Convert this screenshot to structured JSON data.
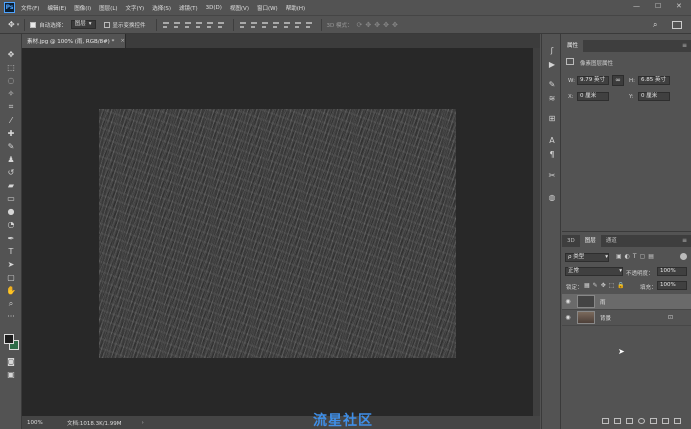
{
  "menubar": {
    "logo": "Ps",
    "items": [
      "文件(F)",
      "编辑(E)",
      "图像(I)",
      "图层(L)",
      "文字(Y)",
      "选择(S)",
      "滤镜(T)",
      "3D(D)",
      "视图(V)",
      "窗口(W)",
      "帮助(H)"
    ],
    "minimize": "—",
    "maximize": "☐",
    "close": "✕"
  },
  "options": {
    "auto_select_label": "自动选择：",
    "auto_select_value": "图层",
    "show_transform_label": "显示变换控件",
    "mode_3d_label": "3D 模式："
  },
  "document": {
    "tab_label": "素材.jpg @ 100% (雨, RGB/8#) *",
    "close": "×"
  },
  "status": {
    "zoom": "100%",
    "doc_info": "文档:1018.3K/1.99M",
    "arrow": "›"
  },
  "watermark": "流星社区",
  "properties": {
    "tab": "属性",
    "section": "像素图层属性",
    "w_label": "W:",
    "w_value": "9.79 英寸",
    "h_label": "H:",
    "h_value": "6.85 英寸",
    "x_label": "X:",
    "x_value": "0 厘米",
    "y_label": "Y:",
    "y_value": "0 厘米",
    "link": "∞"
  },
  "layers": {
    "tabs": [
      "3D",
      "图层",
      "通道"
    ],
    "filter_label": "ρ 类型",
    "blend_mode": "正常",
    "opacity_label": "不透明度：",
    "opacity_value": "100%",
    "lock_label": "锁定：",
    "fill_label": "填充：",
    "fill_value": "100%",
    "rows": [
      {
        "name": "雨"
      },
      {
        "name": "背景"
      }
    ]
  }
}
